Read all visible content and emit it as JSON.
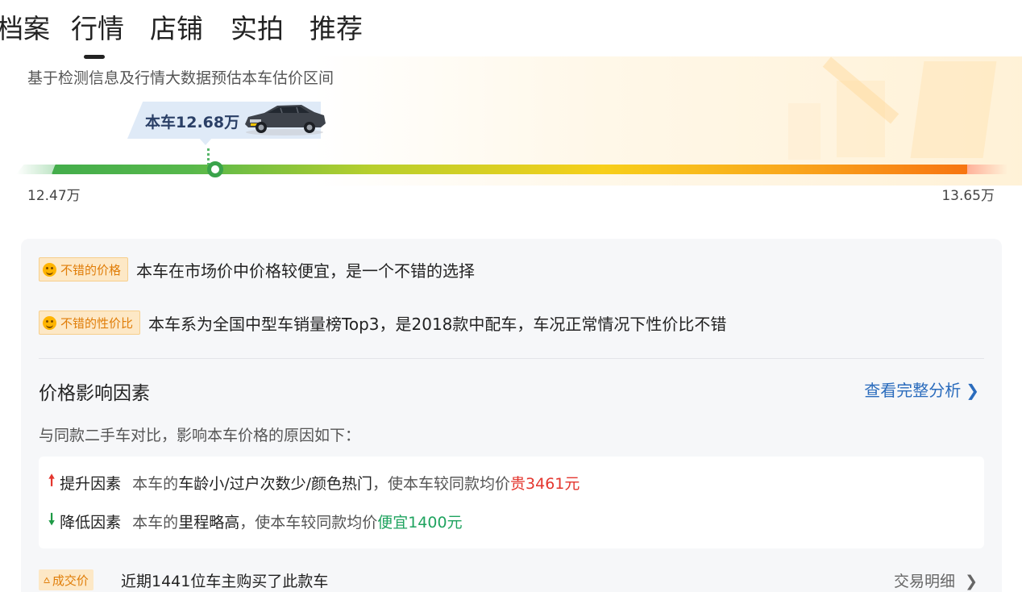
{
  "tabs": [
    {
      "label": "档案"
    },
    {
      "label": "行情"
    },
    {
      "label": "店铺"
    },
    {
      "label": "实拍"
    },
    {
      "label": "推荐"
    }
  ],
  "active_tab_index": 1,
  "estimate": {
    "description": "基于检测信息及行情大数据预估本车估价区间",
    "current_price_label": "本车12.68万",
    "range_min": "12.47万",
    "range_max": "13.65万",
    "current_price_fraction": 0.178,
    "colors": {
      "low": "#43ad4b",
      "mid": "#f7cf1a",
      "high": "#f77411"
    }
  },
  "evaluations": [
    {
      "badge": "不错的价格",
      "text": "本车在市场价中价格较便宜，是一个不错的选择"
    },
    {
      "badge": "不错的性价比",
      "text": "本车系为全国中型车销量榜Top3，是2018款中配车，车况正常情况下性价比不错"
    }
  ],
  "factors": {
    "title": "价格影响因素",
    "link": "查看完整分析",
    "subtitle": "与同款二手车对比，影响本车价格的原因如下：",
    "up": {
      "label": "提升因素",
      "prefix": "本车的",
      "items": "车龄小/过户次数少/颜色热门",
      "suffix": "，使本车较同款均价",
      "value": "贵3461元"
    },
    "down": {
      "label": "降低因素",
      "prefix": "本车的",
      "items": "里程略高",
      "suffix": "，使本车较同款均价",
      "value": "便宜1400元"
    }
  },
  "deal": {
    "badge": "成交价",
    "text": "近期1441位车主购买了此款车",
    "link": "交易明细"
  },
  "icons": {
    "chevron": "chevron-right-icon",
    "up": "arrow-up-icon",
    "down": "arrow-down-icon",
    "smile": "smile-icon",
    "deal": "tag-icon"
  }
}
